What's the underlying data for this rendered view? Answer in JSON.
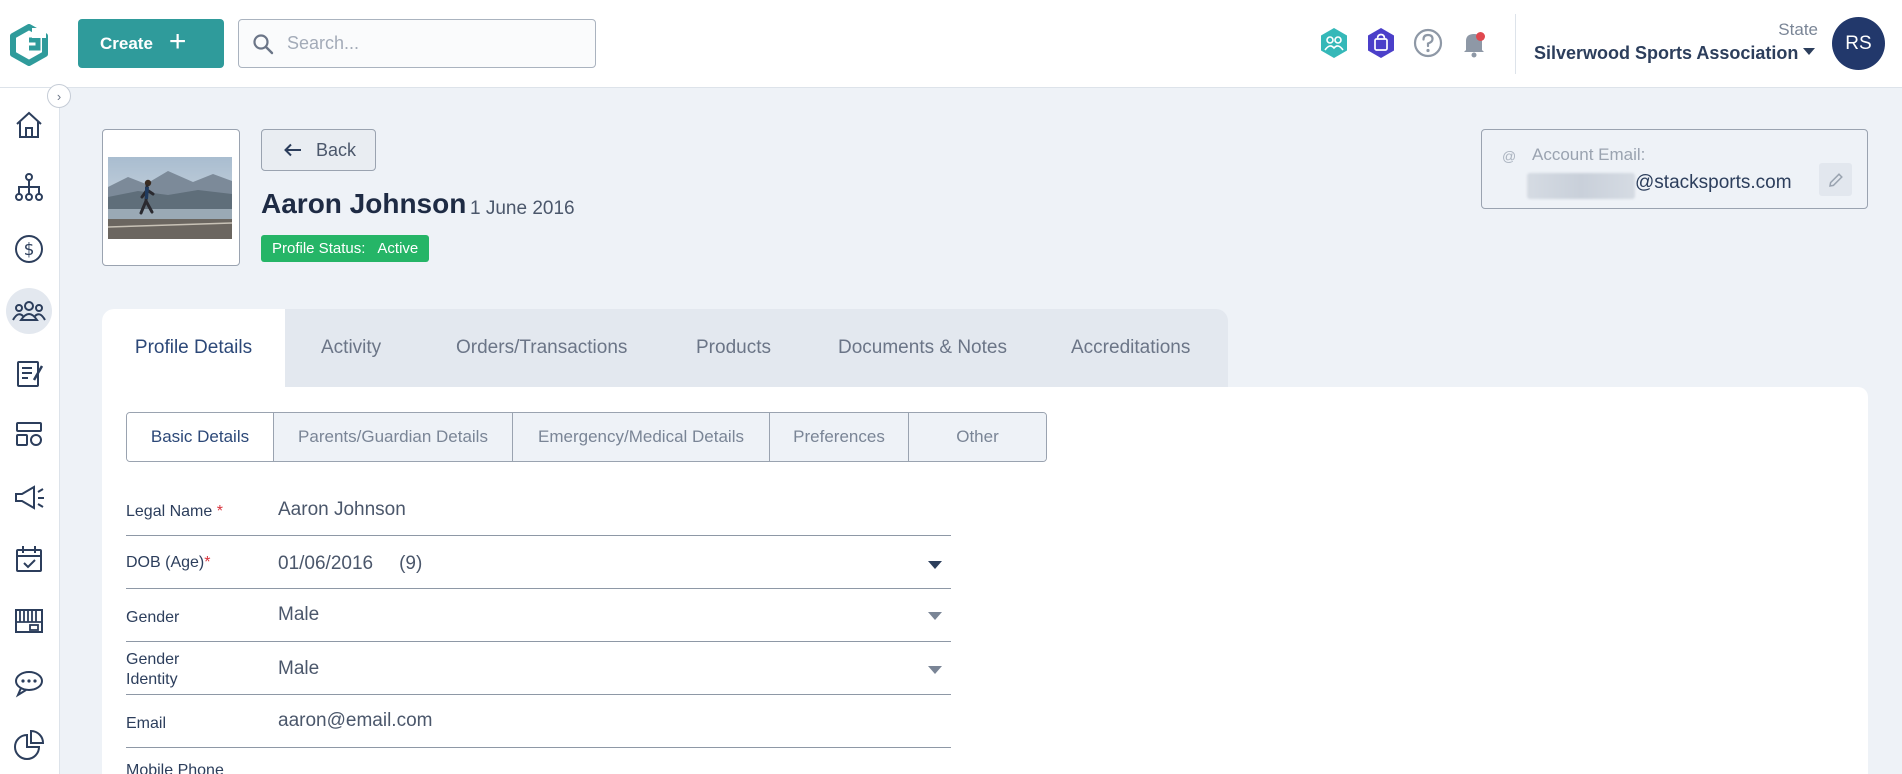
{
  "header": {
    "create_label": "Create",
    "search_placeholder": "Search...",
    "state_label": "State",
    "org_name": "Silverwood Sports Association",
    "avatar_initials": "RS"
  },
  "profile": {
    "back_label": "Back",
    "name": "Aaron Johnson",
    "dob_display": "1 June 2016",
    "status_label": "Profile Status:",
    "status_value": "Active",
    "account_email_label": "Account Email:",
    "account_email_domain": "@stacksports.com"
  },
  "main_tabs": [
    {
      "label": "Profile Details"
    },
    {
      "label": "Activity"
    },
    {
      "label": "Orders/Transactions"
    },
    {
      "label": "Products"
    },
    {
      "label": "Documents & Notes"
    },
    {
      "label": "Accreditations"
    }
  ],
  "sub_tabs": [
    {
      "label": "Basic Details"
    },
    {
      "label": "Parents/Guardian Details"
    },
    {
      "label": "Emergency/Medical Details"
    },
    {
      "label": "Preferences"
    },
    {
      "label": "Other"
    }
  ],
  "form": {
    "legal_name_label": "Legal Name",
    "legal_name_value": "Aaron Johnson",
    "dob_label": "DOB (Age)",
    "dob_value": "01/06/2016",
    "age_value": "(9)",
    "gender_label": "Gender",
    "gender_value": "Male",
    "gender_identity_label": "Gender Identity",
    "gender_identity_value": "Male",
    "email_label": "Email",
    "email_value": "aaron@email.com",
    "mobile_label": "Mobile Phone"
  },
  "colors": {
    "accent": "#2f9b9b",
    "navy": "#22386b",
    "status_active": "#25b567",
    "required": "#d8323c"
  }
}
